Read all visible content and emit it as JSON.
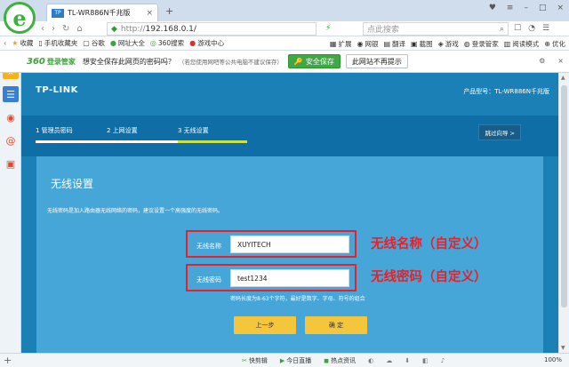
{
  "browser": {
    "tab_title": "TL-WR886N千兆版",
    "tab_icon_text": "TP",
    "url_protocol": "http://",
    "url_host": "192.168.0.1/",
    "search_placeholder": "点此搜索"
  },
  "bookmarks": {
    "items": [
      {
        "icon": "★",
        "label": "收藏",
        "color": "#f0a020"
      },
      {
        "icon": "▯",
        "label": "手机收藏夹",
        "color": "#555555"
      },
      {
        "icon": "▢",
        "label": "谷歌",
        "color": "#555555"
      },
      {
        "icon": "●",
        "label": "网址大全",
        "color": "#3aa43a"
      },
      {
        "icon": "◎",
        "label": "360搜索",
        "color": "#3aa43a"
      },
      {
        "icon": "●",
        "label": "游戏中心",
        "color": "#d83030"
      }
    ],
    "right_items": [
      {
        "icon": "▦",
        "label": "扩展"
      },
      {
        "icon": "◉",
        "label": "网银"
      },
      {
        "icon": "▤",
        "label": "翻译"
      },
      {
        "icon": "▣",
        "label": "截图"
      },
      {
        "icon": "◈",
        "label": "游戏"
      },
      {
        "icon": "◍",
        "label": "登录管家"
      },
      {
        "icon": "▥",
        "label": "阅读模式"
      },
      {
        "icon": "⊕",
        "label": "优化"
      }
    ]
  },
  "password_bar": {
    "logo": "360",
    "brand": "登录管家",
    "question": "想安全保存此网页的密码吗？",
    "hint": "（若您使用网吧等公共电脑不建议保存）",
    "save_label": "安全保存",
    "never_label": "此网站不再提示"
  },
  "router": {
    "logo": "TP-LINK",
    "model": "产品型号：TL-WR886N千兆版",
    "steps": [
      "1 管理员密码",
      "2 上网设置",
      "3 无线设置"
    ],
    "skip_label": "跳过向导 >",
    "panel_title": "无线设置",
    "panel_desc": "无线密码是加入路由器无线网络的密码，建议设置一个高强度的无线密码。",
    "ssid_label": "无线名称",
    "ssid_value": "XUYITECH",
    "pwd_label": "无线密码",
    "pwd_value": "test1234",
    "pwd_note": "密码长度为8-63个字符，最好是数字、字母、符号的组合",
    "annot_ssid": "无线名称（自定义）",
    "annot_pwd": "无线密码（自定义）",
    "prev_label": "上一步",
    "ok_label": "确 定"
  },
  "status_bar": {
    "items": [
      "快剪辑",
      "今日直播",
      "热点资讯"
    ],
    "zoom": "100%"
  },
  "colors": {
    "router_bg": "#1a80b6",
    "panel_bg": "#47a6d8",
    "step_done": "#ffffff",
    "step_active": "#c8e24a",
    "button_yellow": "#f5c53c",
    "annotation_red": "#e8202a"
  }
}
